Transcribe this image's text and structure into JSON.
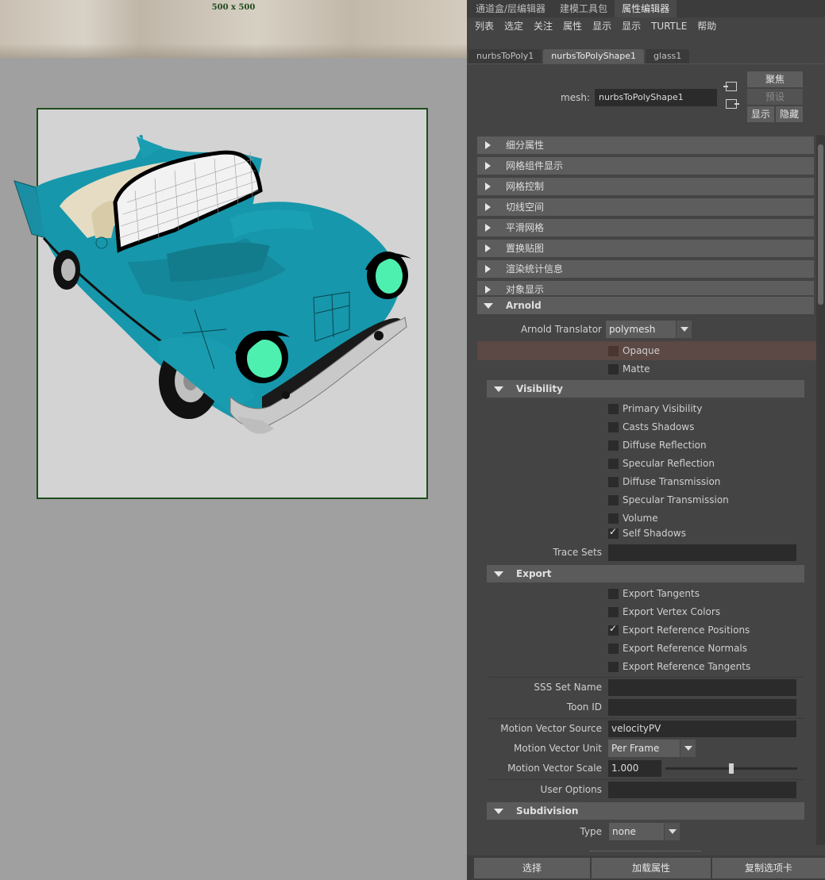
{
  "viewport": {
    "resolution_label": "500 x 500"
  },
  "panel_tabs": [
    {
      "label": "通道盒/层编辑器",
      "active": false
    },
    {
      "label": "建模工具包",
      "active": false
    },
    {
      "label": "属性编辑器",
      "active": true
    }
  ],
  "menu": [
    "列表",
    "选定",
    "关注",
    "属性",
    "显示",
    "显示",
    "TURTLE",
    "帮助"
  ],
  "node_tabs": [
    {
      "label": "nurbsToPoly1",
      "active": false
    },
    {
      "label": "nurbsToPolyShape1",
      "active": true
    },
    {
      "label": "glass1",
      "active": false
    }
  ],
  "mesh": {
    "label": "mesh:",
    "value": "nurbsToPolyShape1",
    "focus_label": "聚焦",
    "preset_label": "预设",
    "show_label": "显示",
    "hide_label": "隐藏"
  },
  "sections": [
    "细分属性",
    "网格组件显示",
    "网格控制",
    "切线空间",
    "平滑网格",
    "置换贴图",
    "渲染统计信息",
    "对象显示"
  ],
  "arnold": {
    "title": "Arnold",
    "translator_label": "Arnold Translator",
    "translator_value": "polymesh",
    "opaque": {
      "label": "Opaque",
      "checked": false
    },
    "matte": {
      "label": "Matte",
      "checked": false
    },
    "visibility": {
      "title": "Visibility",
      "items": [
        {
          "label": "Primary Visibility",
          "checked": false
        },
        {
          "label": "Casts Shadows",
          "checked": false
        },
        {
          "label": "Diffuse Reflection",
          "checked": false
        },
        {
          "label": "Specular Reflection",
          "checked": false
        },
        {
          "label": "Diffuse Transmission",
          "checked": false
        },
        {
          "label": "Specular Transmission",
          "checked": false
        },
        {
          "label": "Volume",
          "checked": false
        },
        {
          "label": "Self Shadows",
          "checked": true
        }
      ],
      "trace_sets_label": "Trace Sets",
      "trace_sets_value": ""
    },
    "export": {
      "title": "Export",
      "items": [
        {
          "label": "Export Tangents",
          "checked": false
        },
        {
          "label": "Export Vertex Colors",
          "checked": false
        },
        {
          "label": "Export Reference Positions",
          "checked": true
        },
        {
          "label": "Export Reference Normals",
          "checked": false
        },
        {
          "label": "Export Reference Tangents",
          "checked": false
        }
      ]
    },
    "sss_set_name_label": "SSS Set Name",
    "sss_set_name_value": "",
    "toon_id_label": "Toon ID",
    "toon_id_value": "",
    "motion_vector_source_label": "Motion Vector Source",
    "motion_vector_source_value": "velocityPV",
    "motion_vector_unit_label": "Motion Vector Unit",
    "motion_vector_unit_value": "Per Frame",
    "motion_vector_scale_label": "Motion Vector Scale",
    "motion_vector_scale_value": "1.000",
    "motion_vector_scale_slider_fraction": 0.5,
    "user_options_label": "User Options",
    "user_options_value": "",
    "subdivision": {
      "title": "Subdivision",
      "type_label": "Type",
      "type_value": "none"
    }
  },
  "bottom_buttons": [
    "选择",
    "加载属性",
    "复制选项卡"
  ],
  "colors": {
    "car_body": "#1797ab",
    "headlight": "#4ef0b0",
    "frame_border": "#1d4d1d",
    "opaque_highlight": "#5c4844"
  }
}
